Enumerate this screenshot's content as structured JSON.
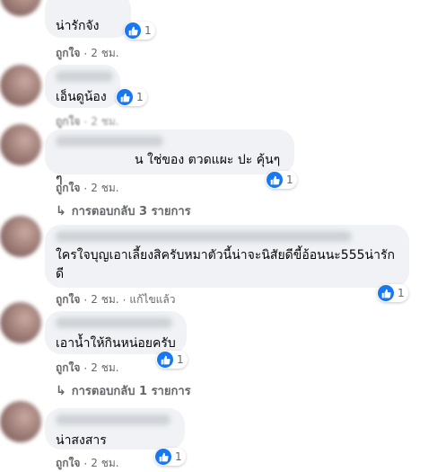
{
  "comments": [
    {
      "text": "น่ารักจัง",
      "reaction_count": "1",
      "like_label": "ถูกใจ",
      "dot": "·",
      "time": "2 ชม."
    },
    {
      "text": "เอ็นดูน้อง",
      "reaction_count": "1",
      "like_label": "ถูกใจ",
      "dot": "·",
      "time": "2 ชม."
    },
    {
      "text": "น ใช่ของ ตวดแผะ ปะ คุ้นๆๆ",
      "reaction_count": "1",
      "like_label": "ถูกใจ",
      "dot": "·",
      "time": "2 ชม."
    },
    {
      "text": "ใครใจบุญเอาเลี้ยงสิครับหมาตัวนี้น่าจะนิสัยดีขี้อ้อนนะ555น่ารัก\nดี",
      "reaction_count": "1",
      "like_label": "ถูกใจ",
      "dot": "·",
      "time": "2 ชม.",
      "edited": "แก้ไขแล้ว"
    },
    {
      "text": "เอาน้ำให้กินหน่อยครับ",
      "reaction_count": "1",
      "like_label": "ถูกใจ",
      "dot": "·",
      "time": "2 ชม."
    },
    {
      "text": "น่าสงสาร",
      "reaction_count": "1",
      "like_label": "ถูกใจ",
      "dot": "·",
      "time": "2 ชม."
    }
  ],
  "replies": [
    {
      "arrow": "↳",
      "label": "การตอบกลับ 3 รายการ"
    },
    {
      "arrow": "↳",
      "label": "การตอบกลับ 1 รายการ"
    }
  ],
  "colors": {
    "like_blue": "#1877f2",
    "bubble": "#f0f2f5",
    "meta_gray": "#65676b"
  }
}
